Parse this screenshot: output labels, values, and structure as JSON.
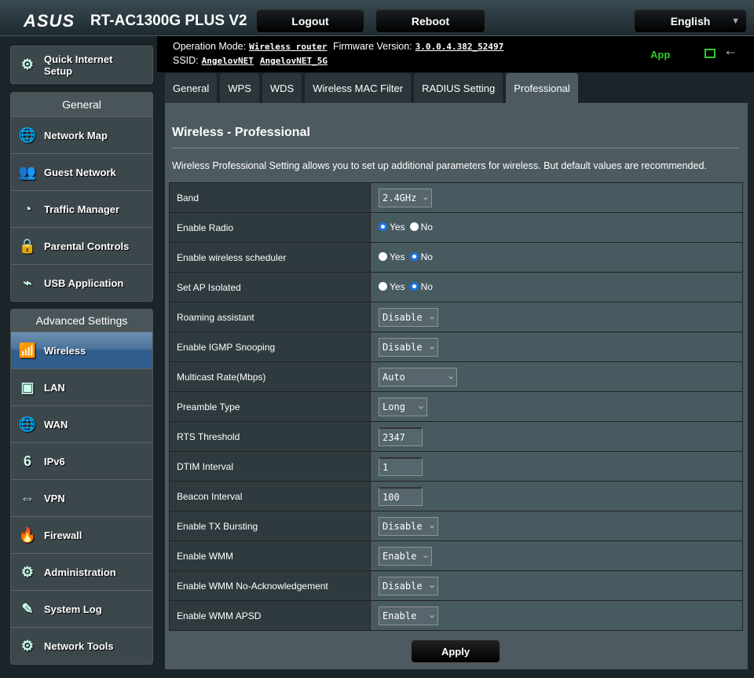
{
  "header": {
    "logo": "ASUS",
    "model": "RT-AC1300G PLUS V2",
    "logout": "Logout",
    "reboot": "Reboot",
    "language": "English"
  },
  "info": {
    "op_mode_label": "Operation Mode:",
    "op_mode": "Wireless router",
    "fw_label": "Firmware Version:",
    "fw": "3.0.0.4.382_52497",
    "ssid_label": "SSID:",
    "ssid1": "AngelovNET",
    "ssid2": "AngelovNET_5G",
    "app": "App"
  },
  "sidebar": {
    "quick": "Quick Internet Setup",
    "general_title": "General",
    "general": [
      {
        "label": "Network Map",
        "icon": "🌐"
      },
      {
        "label": "Guest Network",
        "icon": "👥"
      },
      {
        "label": "Traffic Manager",
        "icon": "◔"
      },
      {
        "label": "Parental Controls",
        "icon": "🔒"
      },
      {
        "label": "USB Application",
        "icon": "⌁"
      }
    ],
    "advanced_title": "Advanced Settings",
    "advanced": [
      {
        "label": "Wireless",
        "icon": "📶"
      },
      {
        "label": "LAN",
        "icon": "▣"
      },
      {
        "label": "WAN",
        "icon": "🌐"
      },
      {
        "label": "IPv6",
        "icon": "6"
      },
      {
        "label": "VPN",
        "icon": "⇔"
      },
      {
        "label": "Firewall",
        "icon": "🔥"
      },
      {
        "label": "Administration",
        "icon": "⚙"
      },
      {
        "label": "System Log",
        "icon": "✎"
      },
      {
        "label": "Network Tools",
        "icon": "⚙"
      }
    ]
  },
  "tabs": [
    "General",
    "WPS",
    "WDS",
    "Wireless MAC Filter",
    "RADIUS Setting",
    "Professional"
  ],
  "main": {
    "title": "Wireless - Professional",
    "desc": "Wireless Professional Setting allows you to set up additional parameters for wireless. But default values are recommended.",
    "apply": "Apply",
    "rows": [
      {
        "label": "Band",
        "type": "select",
        "value": "2.4GHz"
      },
      {
        "label": "Enable Radio",
        "type": "radio",
        "yes": "Yes",
        "no": "No",
        "value": "Yes"
      },
      {
        "label": "Enable wireless scheduler",
        "type": "radio",
        "yes": "Yes",
        "no": "No",
        "value": "No"
      },
      {
        "label": "Set AP Isolated",
        "type": "radio",
        "yes": "Yes",
        "no": "No",
        "value": "No"
      },
      {
        "label": "Roaming assistant",
        "type": "select",
        "value": "Disable"
      },
      {
        "label": "Enable IGMP Snooping",
        "type": "select",
        "value": "Disable"
      },
      {
        "label": "Multicast Rate(Mbps)",
        "type": "select",
        "value": "Auto"
      },
      {
        "label": "Preamble Type",
        "type": "select",
        "value": "Long"
      },
      {
        "label": "RTS Threshold",
        "type": "text",
        "value": "2347"
      },
      {
        "label": "DTIM Interval",
        "type": "text",
        "value": "1"
      },
      {
        "label": "Beacon Interval",
        "type": "text",
        "value": "100"
      },
      {
        "label": "Enable TX Bursting",
        "type": "select",
        "value": "Disable"
      },
      {
        "label": "Enable WMM",
        "type": "select",
        "value": "Enable"
      },
      {
        "label": "Enable WMM No-Acknowledgement",
        "type": "select",
        "value": "Disable"
      },
      {
        "label": "Enable WMM APSD",
        "type": "select",
        "value": "Enable"
      }
    ]
  }
}
